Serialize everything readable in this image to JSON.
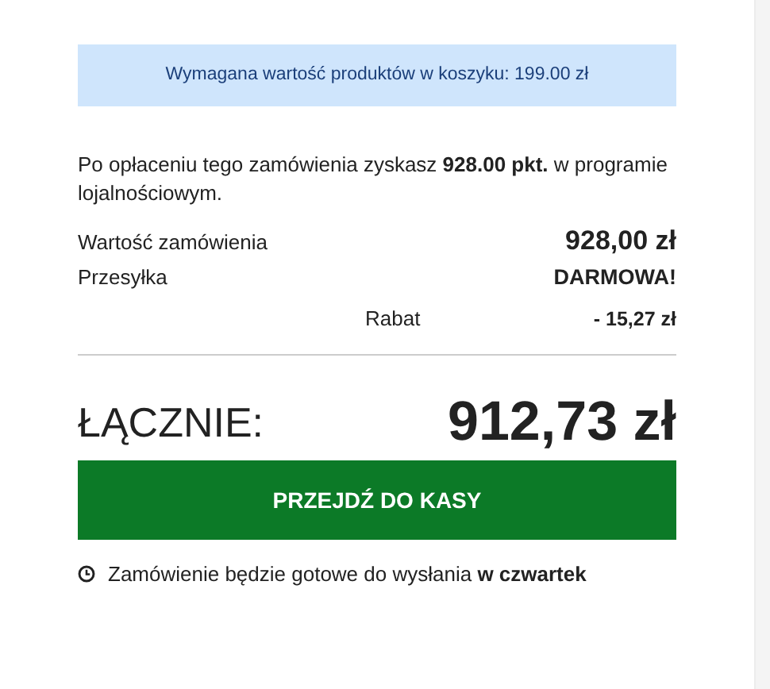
{
  "notice": "Wymagana wartość produktów w koszyku: 199.00 zł",
  "loyalty": "Po opłaceniu tego zamówienia zyskasz **928.00 pkt.** w programie lojalnościowym.",
  "summary": [
    {
      "kind": "main",
      "label": "Wartość zamówienia",
      "value": "928,00 zł"
    },
    {
      "kind": "main",
      "label": "Przesyłka",
      "value": "DARMOWA!"
    },
    {
      "kind": "discount",
      "label": "Rabat",
      "value": "- 15,27 zł"
    }
  ],
  "total": {
    "label": "ŁĄCZNIE:",
    "value": "912,73 zł"
  },
  "checkout_button": "PRZEJDŹ DO KASY",
  "delivery": "Zamówienie będzie gotowe do wysłania **w czwartek**"
}
